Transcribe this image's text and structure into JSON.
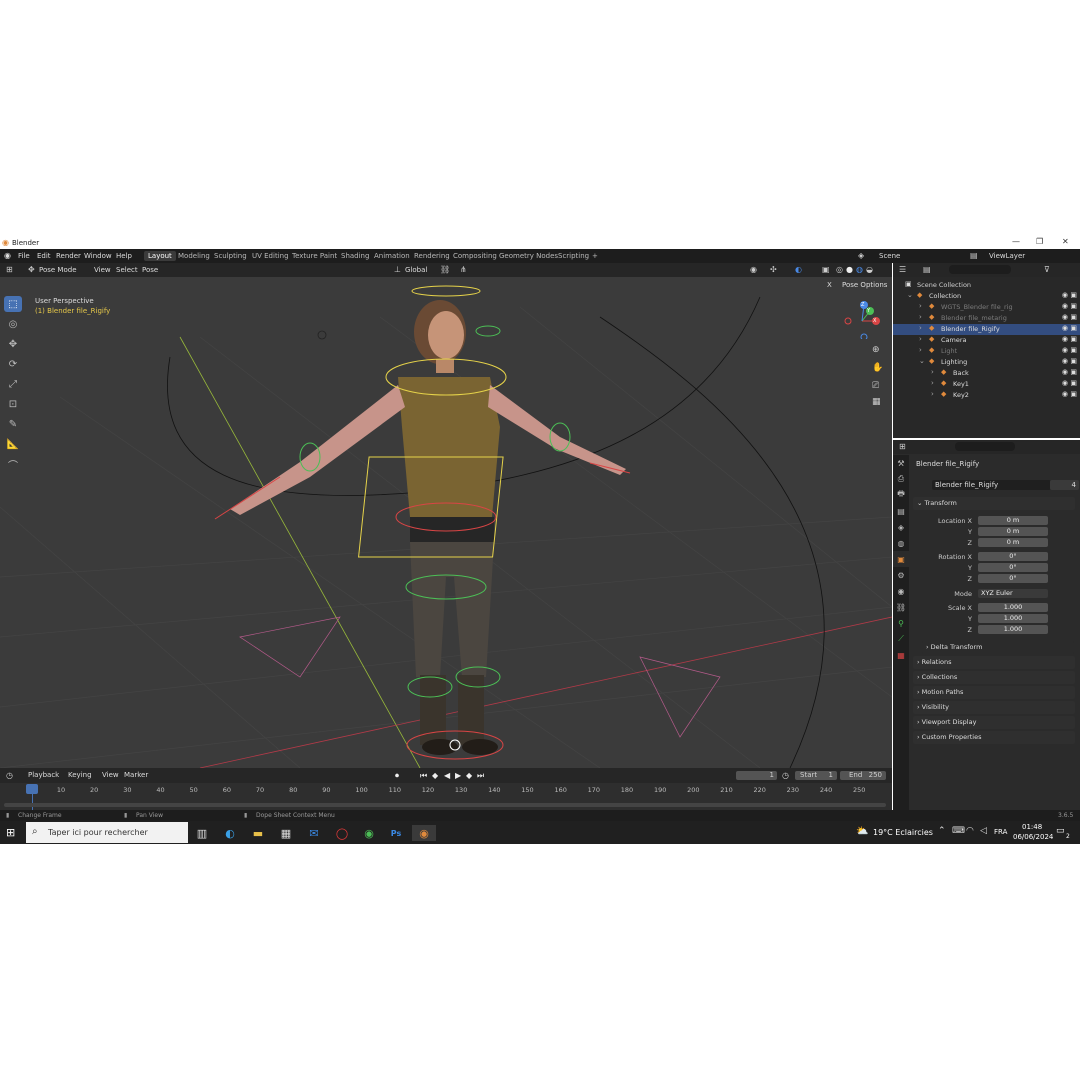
{
  "window": {
    "title": "Blender",
    "controls": [
      "—",
      "❐",
      "✕"
    ]
  },
  "menu": [
    "File",
    "Edit",
    "Render",
    "Window",
    "Help"
  ],
  "workspaces": [
    "Layout",
    "Modeling",
    "Sculpting",
    "UV Editing",
    "Texture Paint",
    "Shading",
    "Animation",
    "Rendering",
    "Compositing",
    "Geometry Nodes",
    "Scripting"
  ],
  "active_workspace": "Layout",
  "scene": {
    "name": "Scene",
    "view_layer": "ViewLayer"
  },
  "viewport_header": {
    "mode": "Pose Mode",
    "view": "View",
    "select": "Select",
    "pose": "Pose",
    "orientation": "Global",
    "pose_options": "Pose Options",
    "x_label": "X"
  },
  "viewport": {
    "perspective": "User Perspective",
    "active_object": "(1) Blender file_Rigify"
  },
  "gizmo": {
    "x": "X",
    "y": "Y",
    "z": "Z"
  },
  "outliner": {
    "root": "Scene Collection",
    "rows": [
      {
        "name": "Collection",
        "indent": 1
      },
      {
        "name": "WGTS_Blender file_rig",
        "indent": 2,
        "dim": true
      },
      {
        "name": "Blender file_metarig",
        "indent": 2,
        "dim": true
      },
      {
        "name": "Blender file_Rigify",
        "indent": 2,
        "selected": true
      },
      {
        "name": "Camera",
        "indent": 2
      },
      {
        "name": "Light",
        "indent": 2,
        "dim": true
      },
      {
        "name": "Lighting",
        "indent": 2
      },
      {
        "name": "Back",
        "indent": 3
      },
      {
        "name": "Key1",
        "indent": 3
      },
      {
        "name": "Key2",
        "indent": 3
      }
    ]
  },
  "properties": {
    "object_title": "Blender file_Rigify",
    "object_name": "Blender file_Rigify",
    "users": "4",
    "transform_header": "Transform",
    "location_label": "Location X",
    "location": [
      "0 m",
      "0 m",
      "0 m"
    ],
    "rotation_label": "Rotation X",
    "rotation": [
      "0°",
      "0°",
      "0°"
    ],
    "mode_label": "Mode",
    "mode": "XYZ Euler",
    "scale_label": "Scale X",
    "scale": [
      "1.000",
      "1.000",
      "1.000"
    ],
    "axis_y": "Y",
    "axis_z": "Z",
    "sections": [
      "Delta Transform",
      "Relations",
      "Collections",
      "Motion Paths",
      "Visibility",
      "Viewport Display",
      "Custom Properties"
    ]
  },
  "timeline": {
    "menus": [
      "Playback",
      "Keying",
      "View",
      "Marker"
    ],
    "current_frame": "1",
    "start_label": "Start",
    "start": "1",
    "end_label": "End",
    "end": "250",
    "ticks": [
      "1",
      "10",
      "20",
      "30",
      "40",
      "50",
      "60",
      "70",
      "80",
      "90",
      "100",
      "110",
      "120",
      "130",
      "140",
      "150",
      "160",
      "170",
      "180",
      "190",
      "200",
      "210",
      "220",
      "230",
      "240",
      "250"
    ]
  },
  "statusbar": {
    "left": "Change Frame",
    "middle": "Pan View",
    "right": "Dope Sheet Context Menu",
    "version": "3.6.5"
  },
  "taskbar": {
    "search_placeholder": "Taper ici pour rechercher",
    "weather": "19°C  Eclaircies",
    "lang": "FRA",
    "time": "01:48",
    "date": "06/06/2024",
    "notif": "2"
  },
  "colors": {
    "accent": "#4772b3",
    "selection": "#334d80",
    "rig_yellow": "#e6d34a",
    "rig_green": "#4cbf56",
    "rig_red": "#d94545"
  }
}
